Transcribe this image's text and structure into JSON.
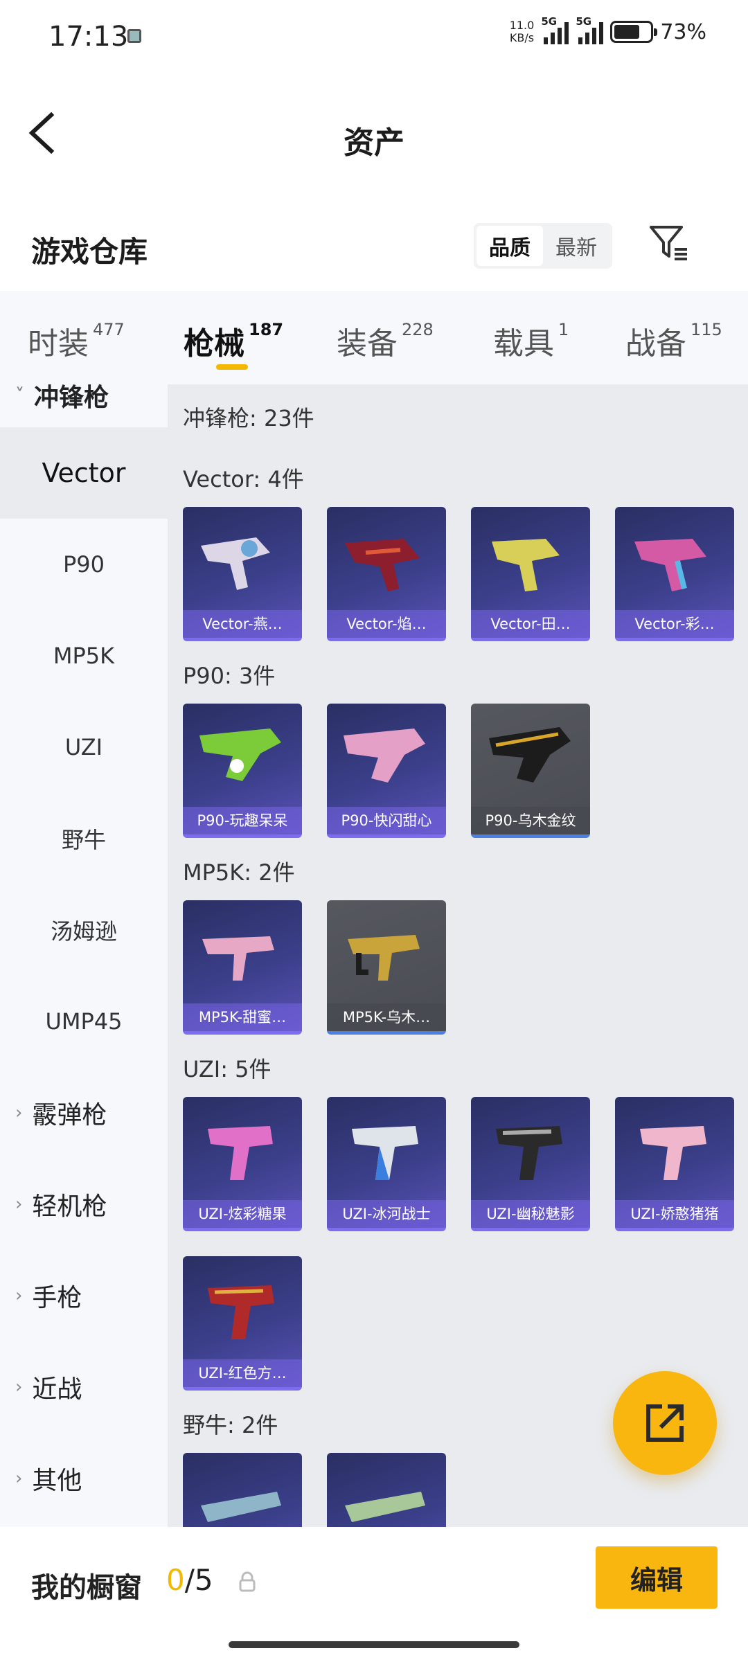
{
  "status": {
    "time": "17:13",
    "speed_top": "11.0",
    "speed_unit": "KB/s",
    "network1": "5G",
    "network2": "5G",
    "battery": "73%"
  },
  "header": {
    "title": "资产"
  },
  "section": {
    "title": "游戏仓库",
    "sort_quality": "品质",
    "sort_newest": "最新"
  },
  "tabs": [
    {
      "label": "时装",
      "count": "477"
    },
    {
      "label": "枪械",
      "count": "187"
    },
    {
      "label": "装备",
      "count": "228"
    },
    {
      "label": "载具",
      "count": "1"
    },
    {
      "label": "战备",
      "count": "115"
    }
  ],
  "nav": {
    "cut_group": "冲锋枪",
    "items": [
      "Vector",
      "P90",
      "MP5K",
      "UZI",
      "野牛",
      "汤姆逊",
      "UMP45"
    ],
    "groups": [
      "霰弹枪",
      "轻机枪",
      "手枪",
      "近战",
      "其他"
    ]
  },
  "content": {
    "total": "冲锋枪: 23件",
    "groups": [
      {
        "title": "Vector: 4件",
        "items": [
          "Vector-燕…",
          "Vector-焰…",
          "Vector-田…",
          "Vector-彩…"
        ]
      },
      {
        "title": "P90: 3件",
        "items": [
          "P90-玩趣呆呆",
          "P90-快闪甜心",
          "P90-乌木金纹"
        ]
      },
      {
        "title": "MP5K: 2件",
        "items": [
          "MP5K-甜蜜…",
          "MP5K-乌木…"
        ]
      },
      {
        "title": "UZI: 5件",
        "items": [
          "UZI-炫彩糖果",
          "UZI-冰河战士",
          "UZI-幽秘魅影",
          "UZI-娇憨猪猪",
          "UZI-红色方…"
        ]
      },
      {
        "title": "野牛: 2件",
        "items": [
          "",
          ""
        ]
      }
    ]
  },
  "bottom": {
    "title": "我的橱窗",
    "current": "0",
    "total": "/5",
    "edit": "编辑"
  },
  "colors": {
    "accent": "#f8b60e",
    "card_purple": "#3b3f8a",
    "card_gray": "#4a4c53"
  }
}
